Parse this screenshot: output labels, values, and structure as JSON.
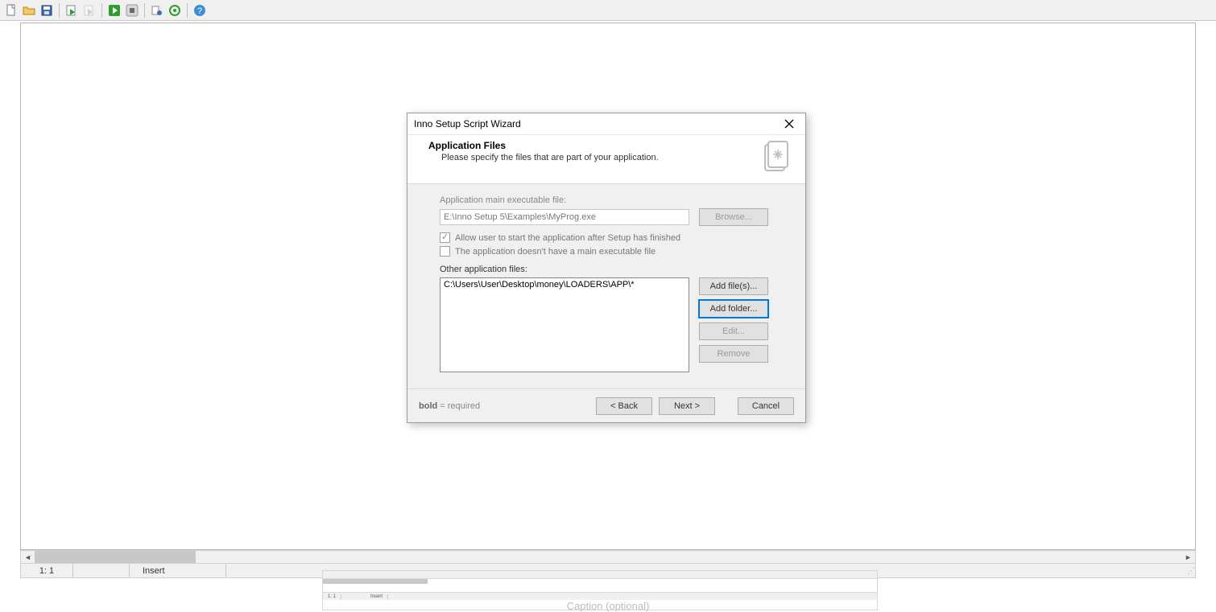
{
  "toolbar": {
    "icons": [
      "new-file",
      "open-folder",
      "save",
      "compile",
      "build-disabled",
      "run",
      "stop",
      "debugger",
      "target",
      "help"
    ]
  },
  "status": {
    "pos": "1:   1",
    "mode": "Insert"
  },
  "thumb": {
    "pos": "1:  1",
    "mode": "Insert"
  },
  "caption_hint": "Caption (optional)",
  "dialog": {
    "title": "Inno Setup Script Wizard",
    "heading": "Application Files",
    "subheading": "Please specify the files that are part of your application.",
    "exe_label": "Application main executable file:",
    "exe_value": "E:\\Inno Setup 5\\Examples\\MyProg.exe",
    "browse": "Browse...",
    "chk_allow": "Allow user to start the application after Setup has finished",
    "chk_nomain": "The application doesn't have a main executable file",
    "other_label": "Other application files:",
    "file_item": "C:\\Users\\User\\Desktop\\money\\LOADERS\\APP\\*",
    "add_files": "Add file(s)...",
    "add_folder": "Add folder...",
    "edit": "Edit...",
    "remove": "Remove",
    "required_bold": "bold",
    "required_rest": " = required",
    "back": "< Back",
    "next": "Next >",
    "cancel": "Cancel"
  }
}
